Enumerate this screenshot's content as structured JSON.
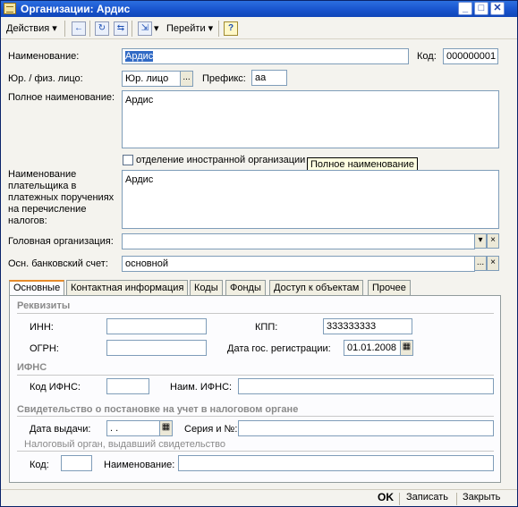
{
  "window": {
    "title": "Организации: Ардис"
  },
  "toolbar": {
    "actions": "Действия",
    "goto": "Перейти",
    "help": "?"
  },
  "form": {
    "name_label": "Наименование:",
    "name_value": "Ардис",
    "code_label": "Код:",
    "code_value": "000000001",
    "legal_label": "Юр. / физ. лицо:",
    "legal_value": "Юр. лицо",
    "prefix_label": "Префикс:",
    "prefix_value": "аа",
    "fullname_label": "Полное наименование:",
    "fullname_value": "Ардис",
    "foreign_label": "отделение иностранной организации",
    "payer_label": "Наименование плательщика в платежных поручениях на перечисление налогов:",
    "payer_value": "Ардис",
    "head_org_label": "Головная организация:",
    "head_org_value": "",
    "bank_label": "Осн. банковский счет:",
    "bank_value": "основной",
    "ellipsis": "...",
    "clear": "×",
    "dropdown": "▾"
  },
  "tooltip": {
    "text": "Полное наименование"
  },
  "tabs": [
    "Основные",
    "Контактная информация",
    "Коды",
    "Фонды",
    "Доступ к объектам",
    "Прочее"
  ],
  "panel": {
    "requisites_title": "Реквизиты",
    "inn_label": "ИНН:",
    "inn_value": "",
    "kpp_label": "КПП:",
    "kpp_value": "333333333",
    "ogrn_label": "ОГРН:",
    "ogrn_value": "",
    "regdate_label": "Дата гос. регистрации:",
    "regdate_value": "01.01.2008",
    "ifns_title": "ИФНС",
    "ifns_code_label": "Код ИФНС:",
    "ifns_code_value": "",
    "ifns_name_label": "Наим. ИФНС:",
    "ifns_name_value": "",
    "cert_title": "Свидетельство о постановке на учет в налоговом органе",
    "issue_date_label": "Дата выдачи:",
    "issue_date_value": " .  .",
    "series_label": "Серия и №:",
    "series_value": "",
    "issuer_title": "Налоговый орган, выдавший свидетельство",
    "issuer_code_label": "Код:",
    "issuer_code_value": "",
    "issuer_name_label": "Наименование:",
    "issuer_name_value": ""
  },
  "bottom": {
    "ok": "OK",
    "save": "Записать",
    "close": "Закрыть"
  },
  "colors": {
    "title_bar": "#1a56cf",
    "selection": "#316ac5",
    "tab_accent": "#e68b2c",
    "tooltip_bg": "#ffffe1"
  }
}
